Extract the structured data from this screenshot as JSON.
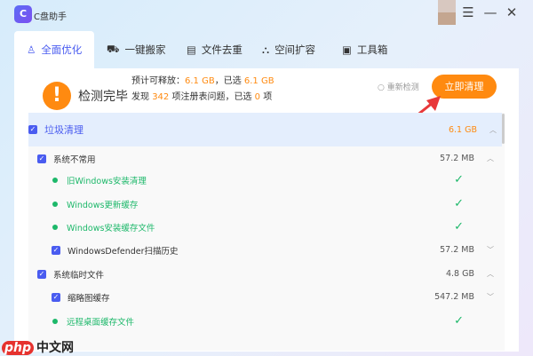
{
  "app": {
    "title": "C盘助手",
    "logo": "C"
  },
  "window": {
    "menu": "☰",
    "minimize": "—",
    "close": "✕"
  },
  "tabs": [
    {
      "label": "全面优化",
      "icon": "rocket-icon",
      "glyph": "♙"
    },
    {
      "label": "一键搬家",
      "icon": "truck-icon",
      "glyph": "⛟"
    },
    {
      "label": "文件去重",
      "icon": "file-icon",
      "glyph": "▤"
    },
    {
      "label": "空间扩容",
      "icon": "expand-icon",
      "glyph": "⛬"
    },
    {
      "label": "工具箱",
      "icon": "toolbox-icon",
      "glyph": "▣"
    }
  ],
  "summary": {
    "status": "检测完毕",
    "release_label": "预计可释放：",
    "release": "6.1 GB",
    "selected_label": "，已选",
    "selected": "6.1 GB",
    "found_label": "发现",
    "found": "342",
    "registry_label": "项注册表问题，已选",
    "registry_selected": "0",
    "unit": "项",
    "redetect": "重新检测",
    "clean_button": "立即清理"
  },
  "list": [
    {
      "level": 0,
      "label": "垃圾清理",
      "size": "6.1 GB",
      "chev": "^",
      "type": "cb"
    },
    {
      "level": 1,
      "label": "系统不常用",
      "size": "57.2 MB",
      "chev": "^",
      "type": "cb"
    },
    {
      "level": 2,
      "label": "旧Windows安装清理",
      "type": "dot"
    },
    {
      "level": 2,
      "label": "Windows更新缓存",
      "type": "dot"
    },
    {
      "level": 2,
      "label": "Windows安装缓存文件",
      "type": "dot"
    },
    {
      "level": 2,
      "label": "WindowsDefender扫描历史",
      "size": "57.2 MB",
      "chev": "v",
      "type": "cb"
    },
    {
      "level": 1,
      "label": "系统临时文件",
      "size": "4.8 GB",
      "chev": "^",
      "type": "cb"
    },
    {
      "level": 2,
      "label": "缩略图缓存",
      "size": "547.2 MB",
      "chev": "v",
      "type": "cb"
    },
    {
      "level": 2,
      "label": "远程桌面缓存文件",
      "type": "dot"
    }
  ],
  "watermark": {
    "a": "php",
    "b": "中文网"
  }
}
